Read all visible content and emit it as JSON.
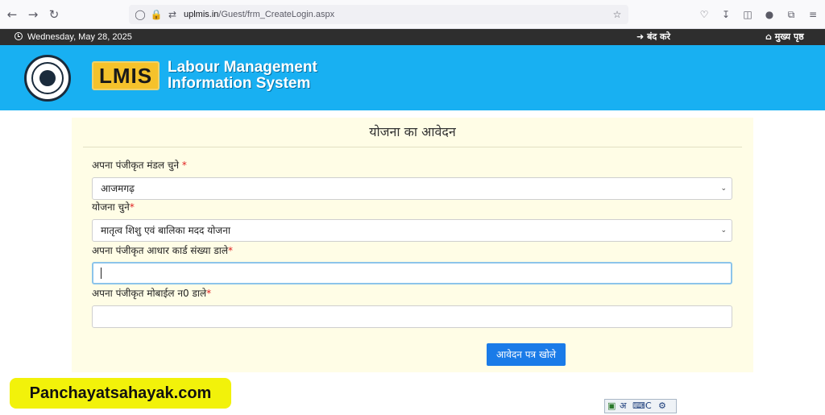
{
  "browser": {
    "url_host": "uplmis.in",
    "url_path": "/Guest/frm_CreateLogin.aspx"
  },
  "topbar": {
    "date": "Wednesday, May 28, 2025",
    "logout_label": "बंद करे",
    "home_label": "मुख्य पृष्ठ"
  },
  "header": {
    "logo_text": "LMIS",
    "brand_line1": "Labour Management",
    "brand_line2": "Information System"
  },
  "form": {
    "title": "योजना का आवेदन",
    "mandal_label": "अपना पंजीकृत मंडल चुने",
    "mandal_value": "आजमगढ़",
    "scheme_label": "योजना चुने",
    "scheme_value": "मातृत्व शिशु एवं बालिका मदद योजना",
    "aadhaar_label": "अपना पंजीकृत आधार कार्ड संख्या डाले",
    "mobile_label": "अपना पंजीकृत मोबाईल न0 डाले",
    "required_mark": "*",
    "submit_label": "आवेदन पत्र खोले"
  },
  "watermark": "Panchayatsahayak.com",
  "ime": {
    "lang_char": "अ",
    "c_char": "C"
  }
}
